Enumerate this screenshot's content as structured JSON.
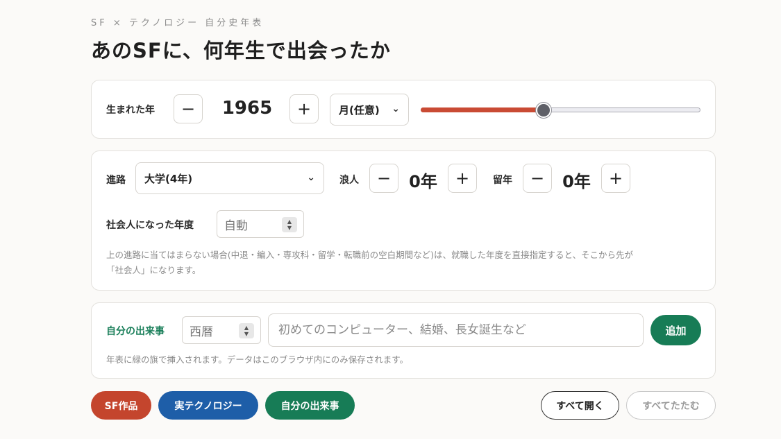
{
  "header": {
    "eyebrow": "SF × テクノロジー 自分史年表",
    "title": "あのSFに、何年生で出会ったか"
  },
  "birth": {
    "label": "生まれた年",
    "minus": "−",
    "plus": "+",
    "year": "1965",
    "month_select": "月(任意)",
    "slider_fraction": 0.44
  },
  "course": {
    "path_label": "進路",
    "path_value": "大学(4年)",
    "ronin_label": "浪人",
    "ronin_value": "0年",
    "ryunen_label": "留年",
    "ryunen_value": "0年",
    "minus": "−",
    "plus": "+",
    "worker_label": "社会人になった年度",
    "worker_value": "自動",
    "note_line1": "上の進路に当てはまらない場合(中退・編入・専攻科・留学・転職前の空白期間など)は、就職した年度を直接指定すると、そこから先が",
    "note_line2": "「社会人」になります。"
  },
  "events": {
    "label": "自分の出来事",
    "era_value": "西暦",
    "input_placeholder": "初めてのコンピューター、結婚、長女誕生など",
    "add_label": "追加",
    "note": "年表に緑の旗で挿入されます。データはこのブラウザ内にのみ保存されます。"
  },
  "filters": {
    "sf": "SF作品",
    "tech": "実テクノロジー",
    "mine": "自分の出来事",
    "expand_all": "すべて開く",
    "collapse_all": "すべてたたむ"
  },
  "colors": {
    "sf": "#c4452d",
    "tech": "#1e5ea8",
    "mine": "#177c56"
  }
}
